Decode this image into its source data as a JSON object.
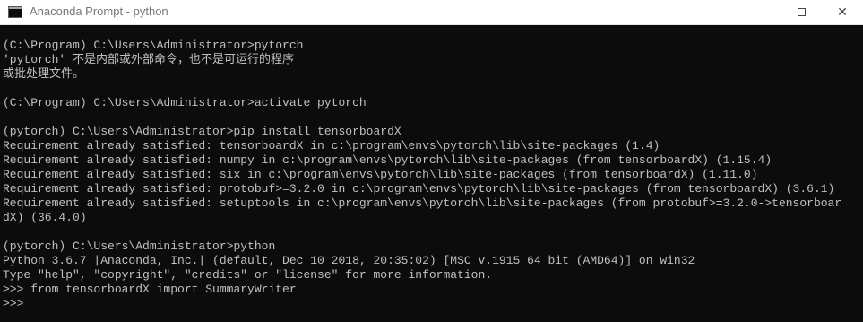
{
  "window": {
    "title": "Anaconda Prompt - python",
    "icon": "console-icon",
    "minimize_glyph": "",
    "maximize_glyph": "",
    "close_glyph": "✕"
  },
  "colors": {
    "console_background": "#0c0c0c",
    "console_text": "#c0c0c0",
    "titlebar_background": "#ffffff"
  },
  "console": {
    "lines": [
      "(C:\\Program) C:\\Users\\Administrator>pytorch",
      "'pytorch' 不是内部或外部命令，也不是可运行的程序",
      "或批处理文件。",
      "",
      "(C:\\Program) C:\\Users\\Administrator>activate pytorch",
      "",
      "(pytorch) C:\\Users\\Administrator>pip install tensorboardX",
      "Requirement already satisfied: tensorboardX in c:\\program\\envs\\pytorch\\lib\\site-packages (1.4)",
      "Requirement already satisfied: numpy in c:\\program\\envs\\pytorch\\lib\\site-packages (from tensorboardX) (1.15.4)",
      "Requirement already satisfied: six in c:\\program\\envs\\pytorch\\lib\\site-packages (from tensorboardX) (1.11.0)",
      "Requirement already satisfied: protobuf>=3.2.0 in c:\\program\\envs\\pytorch\\lib\\site-packages (from tensorboardX) (3.6.1)",
      "Requirement already satisfied: setuptools in c:\\program\\envs\\pytorch\\lib\\site-packages (from protobuf>=3.2.0->tensorboar",
      "dX) (36.4.0)",
      "",
      "(pytorch) C:\\Users\\Administrator>python",
      "Python 3.6.7 |Anaconda, Inc.| (default, Dec 10 2018, 20:35:02) [MSC v.1915 64 bit (AMD64)] on win32",
      "Type \"help\", \"copyright\", \"credits\" or \"license\" for more information.",
      ">>> from tensorboardX import SummaryWriter",
      ">>>"
    ]
  }
}
